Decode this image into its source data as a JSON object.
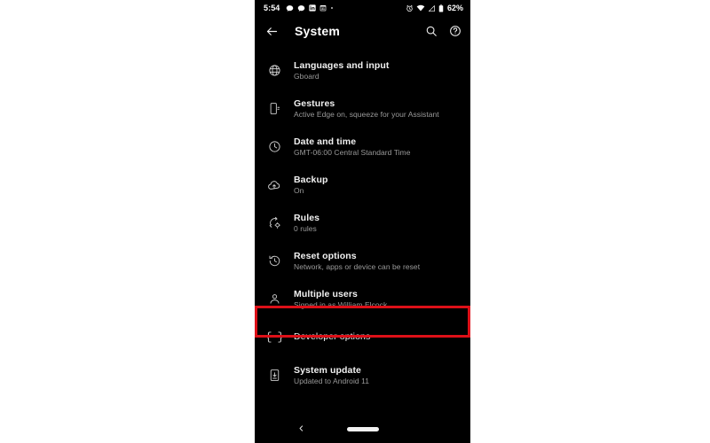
{
  "status_bar": {
    "clock": "5:54",
    "battery_percent": "62%",
    "left_icons": [
      "message-bubble-icon",
      "message-bubble-icon",
      "linkedin-icon",
      "calendar-icon",
      "dot-icon"
    ],
    "right_icons": [
      "alarm-icon",
      "wifi-icon",
      "signal-icon",
      "battery-icon"
    ]
  },
  "app_bar": {
    "title": "System",
    "back_icon": "back-arrow-icon",
    "search_icon": "search-icon",
    "help_icon": "help-circle-icon"
  },
  "settings": {
    "items": [
      {
        "icon": "globe-icon",
        "title": "Languages and input",
        "subtitle": "Gboard"
      },
      {
        "icon": "gesture-squeeze-icon",
        "title": "Gestures",
        "subtitle": "Active Edge on, squeeze for your Assistant"
      },
      {
        "icon": "clock-icon",
        "title": "Date and time",
        "subtitle": "GMT-06:00 Central Standard Time"
      },
      {
        "icon": "cloud-upload-icon",
        "title": "Backup",
        "subtitle": "On"
      },
      {
        "icon": "rules-icon",
        "title": "Rules",
        "subtitle": "0 rules"
      },
      {
        "icon": "restore-history-icon",
        "title": "Reset options",
        "subtitle": "Network, apps or device can be reset"
      },
      {
        "icon": "person-icon",
        "title": "Multiple users",
        "subtitle": "Signed in as William Elcock"
      },
      {
        "icon": "braces-icon",
        "title": "Developer options",
        "subtitle": ""
      },
      {
        "icon": "system-update-icon",
        "title": "System update",
        "subtitle": "Updated to Android 11"
      }
    ]
  },
  "annotation": {
    "target": "Developer options",
    "color": "#dd1018"
  },
  "nav_bar": {
    "back_icon": "chevron-back-icon",
    "home_pill": "home-gesture-pill"
  },
  "colors": {
    "page_background": "#ffffff",
    "screen_background": "#000000",
    "title_text": "#f1f1f1",
    "subtitle_text": "#9a9a9a",
    "icon": "#c9c9c9",
    "annotation_red": "#dd1018"
  }
}
